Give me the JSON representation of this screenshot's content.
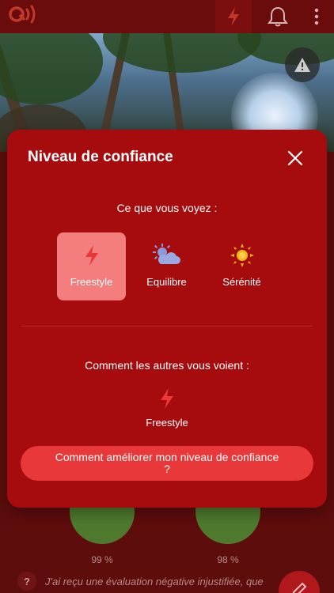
{
  "header": {
    "logo_icon": "signal-logo-icon",
    "bolt_icon": "bolt-icon",
    "bell_icon": "bell-icon",
    "more_icon": "more-vertical-icon"
  },
  "background": {
    "stats": [
      {
        "percent": "99 %",
        "color": "#4f7a2e"
      },
      {
        "percent": "98 %",
        "color": "#4f7a2e"
      }
    ],
    "help_text": "J'ai reçu une évaluation négative injustifiée, que"
  },
  "modal": {
    "title": "Niveau de confiance",
    "what_you_see_label": "Ce que vous voyez :",
    "options": [
      {
        "label": "Freestyle",
        "icon": "bolt-icon",
        "selected": true
      },
      {
        "label": "Equilibre",
        "icon": "sun-cloud-icon",
        "selected": false
      },
      {
        "label": "Sérénité",
        "icon": "sun-icon",
        "selected": false
      }
    ],
    "others_label": "Comment les autres vous voient :",
    "others_value": "Freestyle",
    "improve_button": "Comment améliorer mon niveau de confiance ?"
  },
  "colors": {
    "accent": "#a60c0e",
    "selected_option": "#f47d7d",
    "bolt": "#e8383a",
    "button": "#e8383a"
  }
}
